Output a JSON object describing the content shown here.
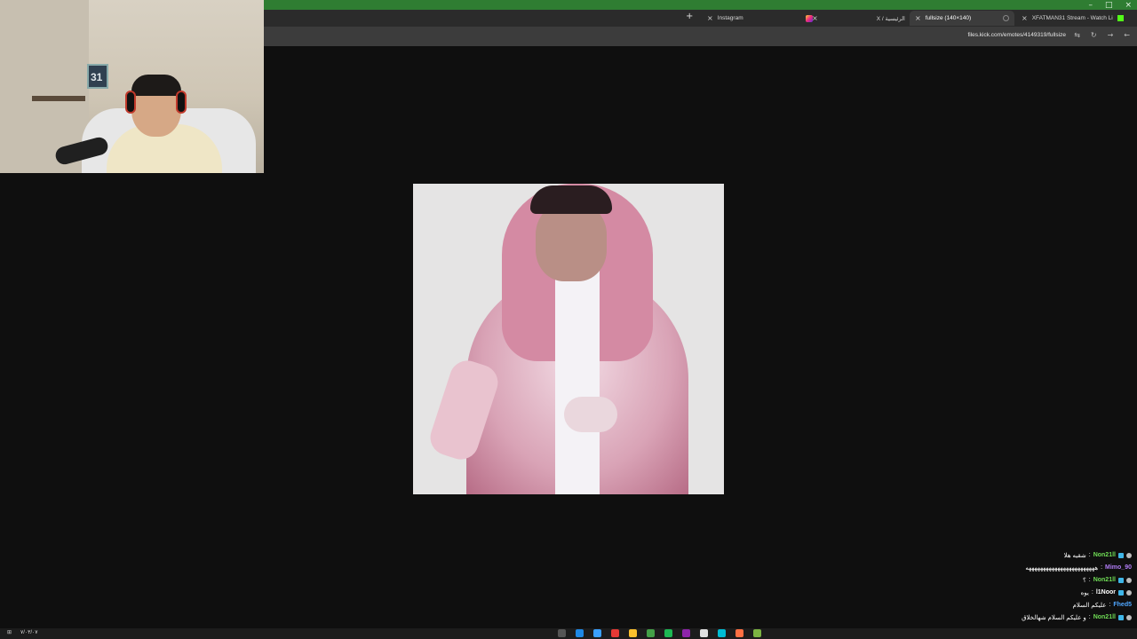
{
  "window": {
    "minimize": "–",
    "maximize": "□",
    "close": "×"
  },
  "tabs": [
    {
      "label": "XFATMAN31 Stream - Watch Li",
      "icon": "kick-icon"
    },
    {
      "label": "fullsize (140×140)",
      "icon": "spinner-icon",
      "active": true
    },
    {
      "label": "X / الرئيسية",
      "icon": "x-icon"
    },
    {
      "label": "Instagram",
      "icon": "instagram-icon"
    }
  ],
  "new_tab_symbol": "+",
  "address": {
    "url": "files.kick.com/emotes/4149319/fullsize"
  },
  "nav": {
    "reload": "↻",
    "back": "←",
    "forward": "→",
    "translate": "⇆",
    "menu": "⋮"
  },
  "webcam": {
    "wall_number": "31"
  },
  "chat": [
    {
      "user": "Non21ll",
      "text": "شقيه هلا",
      "color": "#6fdc55",
      "badges": true
    },
    {
      "user": "Mimo_90",
      "text": "ههههههههههههههههههههههههه",
      "color": "#b07cf5",
      "badges": false
    },
    {
      "user": "Non21ll",
      "text": "؟",
      "color": "#6fdc55",
      "badges": true
    },
    {
      "user": "l1Noor",
      "text": "يوه",
      "color": "#ffffff",
      "badges": true
    },
    {
      "user": "Fhed5",
      "text": "عليكم السلام",
      "color": "#4fa7ff",
      "badges": false
    },
    {
      "user": "Non21ll",
      "text": "و عليكم السلام شهالخلاق",
      "color": "#6fdc55",
      "badges": true
    }
  ],
  "taskbar": {
    "date": "٧/٠٣/٠٧",
    "icon_colors": [
      "#555555",
      "#1e88e5",
      "#3aa0ff",
      "#e53935",
      "#fbc02d",
      "#43a047",
      "#1db954",
      "#8e24aa",
      "#e0e0e0",
      "#00bcd4",
      "#ff7043",
      "#7cb342"
    ]
  }
}
